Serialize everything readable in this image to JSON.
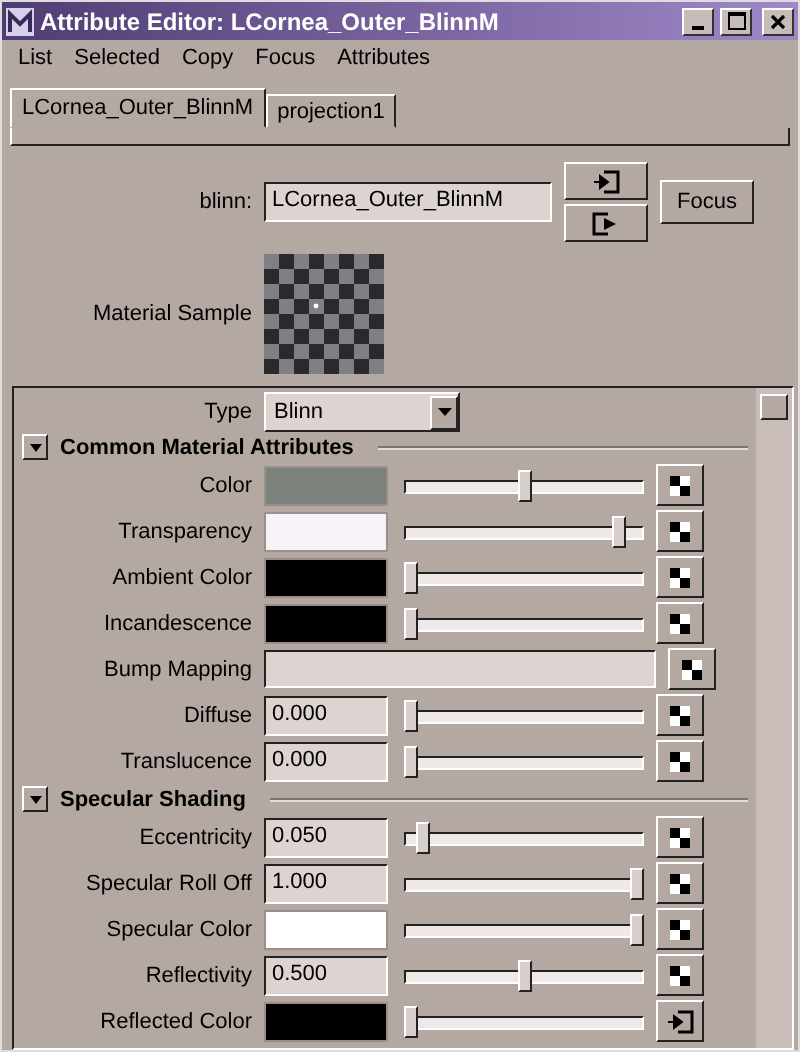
{
  "window": {
    "title": "Attribute Editor: LCornea_Outer_BlinnM"
  },
  "menu": [
    "List",
    "Selected",
    "Copy",
    "Focus",
    "Attributes"
  ],
  "tabs": [
    {
      "label": "LCornea_Outer_BlinnM",
      "selected": true
    },
    {
      "label": "projection1",
      "selected": false
    }
  ],
  "node": {
    "label": "blinn:",
    "value": "LCornea_Outer_BlinnM",
    "focus_button": "Focus"
  },
  "sample": {
    "label": "Material Sample"
  },
  "type": {
    "label": "Type",
    "value": "Blinn"
  },
  "sections": [
    {
      "title": "Common Material Attributes",
      "expanded": true,
      "rows": [
        {
          "kind": "color",
          "label": "Color",
          "color": "#7b827c",
          "level": 0.5,
          "connected": false
        },
        {
          "kind": "color",
          "label": "Transparency",
          "color": "#f6f2f8",
          "level": 0.92,
          "connected": false
        },
        {
          "kind": "color",
          "label": "Ambient Color",
          "color": "#000000",
          "level": 0,
          "connected": false
        },
        {
          "kind": "color",
          "label": "Incandescence",
          "color": "#000000",
          "level": 0,
          "connected": false
        },
        {
          "kind": "map",
          "label": "Bump Mapping",
          "connected": false
        },
        {
          "kind": "number",
          "label": "Diffuse",
          "value": "0.000",
          "level": 0,
          "connected": false
        },
        {
          "kind": "number",
          "label": "Translucence",
          "value": "0.000",
          "level": 0,
          "connected": false
        }
      ]
    },
    {
      "title": "Specular Shading",
      "expanded": true,
      "rows": [
        {
          "kind": "number",
          "label": "Eccentricity",
          "value": "0.050",
          "level": 0.05,
          "connected": false
        },
        {
          "kind": "number",
          "label": "Specular Roll Off",
          "value": "1.000",
          "level": 1,
          "connected": false
        },
        {
          "kind": "color",
          "label": "Specular Color",
          "color": "#ffffff",
          "level": 1,
          "connected": false
        },
        {
          "kind": "number",
          "label": "Reflectivity",
          "value": "0.500",
          "level": 0.5,
          "connected": false
        },
        {
          "kind": "color",
          "label": "Reflected Color",
          "color": "#000000",
          "level": 0,
          "connected": true
        }
      ]
    }
  ]
}
